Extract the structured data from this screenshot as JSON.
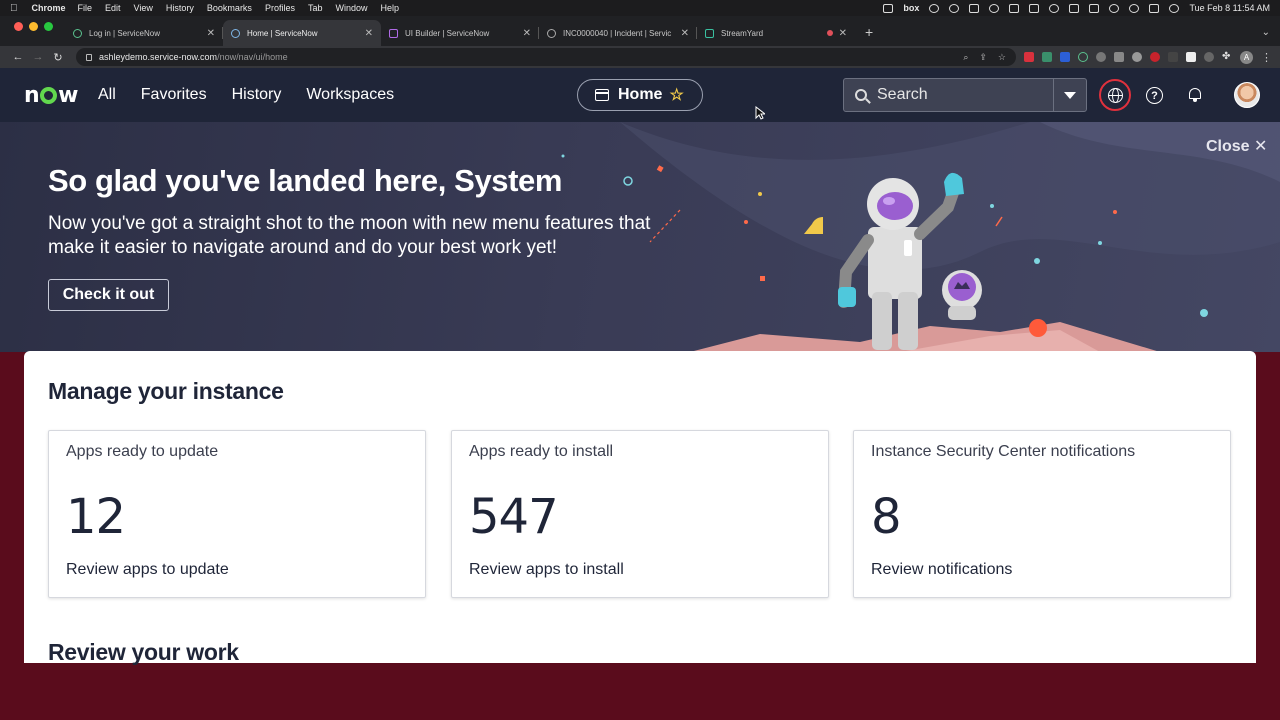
{
  "mac_menu": {
    "app": "Chrome",
    "items": [
      "File",
      "Edit",
      "View",
      "History",
      "Bookmarks",
      "Profiles",
      "Tab",
      "Window",
      "Help"
    ],
    "status_box": "box",
    "clock": "Tue Feb 8  11:54 AM"
  },
  "browser": {
    "tabs": [
      {
        "label": "Log in | ServiceNow"
      },
      {
        "label": "Home | ServiceNow"
      },
      {
        "label": "UI Builder | ServiceNow"
      },
      {
        "label": "INC0000040 | Incident | Servic"
      },
      {
        "label": "StreamYard"
      }
    ],
    "address": {
      "host": "ashleydemo.service-now.com",
      "path": "/now/nav/ui/home"
    },
    "profile_initial": "A"
  },
  "nav": {
    "logo": {
      "n": "n",
      "w": "w"
    },
    "links": [
      "All",
      "Favorites",
      "History",
      "Workspaces"
    ],
    "home_pill": "Home",
    "search_label": "Search"
  },
  "hero": {
    "title": "So glad you've landed here, System",
    "subtitle": "Now you've got a straight shot to the moon with new menu features that make it easier to navigate around and do your best work yet!",
    "cta": "Check it out",
    "close": "Close"
  },
  "main": {
    "heading": "Manage your instance",
    "cards": [
      {
        "title": "Apps ready to update",
        "count": "12",
        "link": "Review apps to update"
      },
      {
        "title": "Apps ready to install",
        "count": "547",
        "link": "Review apps to install"
      },
      {
        "title": "Instance Security Center notifications",
        "count": "8",
        "link": "Review notifications"
      }
    ],
    "next_heading": "Review your work"
  },
  "colors": {
    "nav_bg": "#1f2538",
    "logo_accent": "#62d84e",
    "globe_ring": "#e0313d",
    "star": "#f1c94a"
  }
}
